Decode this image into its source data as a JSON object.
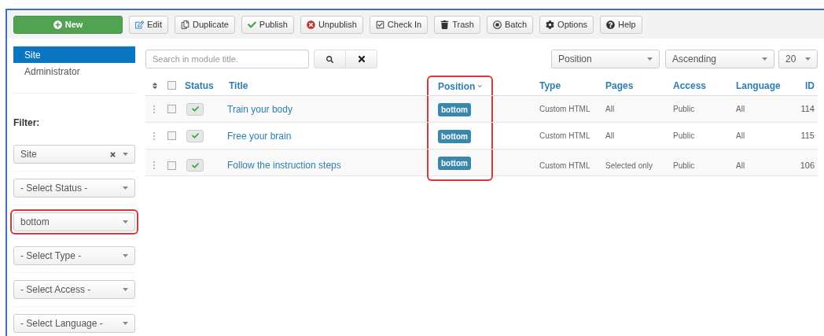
{
  "toolbar": [
    {
      "label": "New",
      "kind": "primary"
    },
    {
      "label": "Edit",
      "kind": "default"
    },
    {
      "label": "Duplicate",
      "kind": "default"
    },
    {
      "label": "Publish",
      "kind": "default"
    },
    {
      "label": "Unpublish",
      "kind": "default"
    },
    {
      "label": "Check In",
      "kind": "default"
    },
    {
      "label": "Trash",
      "kind": "default"
    },
    {
      "label": "Batch",
      "kind": "default"
    },
    {
      "label": "Options",
      "kind": "default"
    },
    {
      "label": "Help",
      "kind": "default"
    }
  ],
  "sidebar": {
    "items": [
      {
        "label": "Site",
        "selected": true
      },
      {
        "label": "Administrator",
        "selected": false
      }
    ],
    "filter_label": "Filter:",
    "filters": [
      {
        "value": "Site",
        "clearable": true,
        "highlighted": false
      },
      {
        "value": "- Select Status -",
        "clearable": false,
        "highlighted": false
      },
      {
        "value": "bottom",
        "clearable": false,
        "highlighted": true
      },
      {
        "value": "- Select Type -",
        "clearable": false,
        "highlighted": false
      },
      {
        "value": "- Select Access -",
        "clearable": false,
        "highlighted": false
      },
      {
        "value": "- Select Language -",
        "clearable": false,
        "highlighted": false
      }
    ]
  },
  "search": {
    "placeholder": "Search in module title."
  },
  "sort_selects": [
    "Position",
    "Ascending",
    "20"
  ],
  "table": {
    "select_all_checked": false,
    "columns": [
      {
        "label": "Status",
        "sorted": false,
        "highlighted": false
      },
      {
        "label": "Title",
        "sorted": false,
        "highlighted": false
      },
      {
        "label": "Position",
        "sorted": true,
        "highlighted": true
      },
      {
        "label": "Type",
        "sorted": false,
        "highlighted": false
      },
      {
        "label": "Pages",
        "sorted": false,
        "highlighted": false
      },
      {
        "label": "Access",
        "sorted": false,
        "highlighted": false
      },
      {
        "label": "Language",
        "sorted": false,
        "highlighted": false
      },
      {
        "label": "ID",
        "sorted": false,
        "highlighted": false
      }
    ],
    "rows": [
      {
        "checked": false,
        "published": true,
        "title": "Train your body",
        "position": "bottom",
        "type": "Custom HTML",
        "pages": "All",
        "access": "Public",
        "language": "All",
        "id": "114"
      },
      {
        "checked": false,
        "published": true,
        "title": "Free your brain",
        "position": "bottom",
        "type": "Custom HTML",
        "pages": "All",
        "access": "Public",
        "language": "All",
        "id": "115"
      },
      {
        "checked": false,
        "published": true,
        "title": "Follow the instruction steps",
        "position": "bottom",
        "type": "Custom HTML",
        "pages": "Selected only",
        "access": "Public",
        "language": "All",
        "id": "106"
      }
    ]
  }
}
